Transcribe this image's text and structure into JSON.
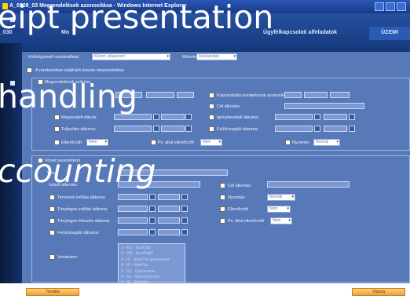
{
  "window": {
    "title": "A_0308_03 Megrendelések azonosítása - Windows Internet Explorer"
  },
  "header": {
    "tab_left": "_030",
    "tab_left_2": "Mo",
    "context": "_03",
    "tab_ugyf": "Ügyfélkapcsolati alfeladatok",
    "tab_uzemi": "ÜZEMI"
  },
  "top": {
    "kolts_label": "Költségviselő vasútvállalat",
    "kolts_value": "Kérem válasszon!",
    "muvelet_label": "Művelet",
    "muvelet_value": "Reklamálás",
    "all_orders_label": "A rendszerben található összes megrendelése"
  },
  "panel1": {
    "title": "Megrendelések szűrése",
    "kapcsolat": "Kapcsolódás kontaktusok azonosító:",
    "cel": "Cél állomás:",
    "megrendelt": "Megrendelt dátum:",
    "igeny": "Igénybevételi dátuma:",
    "teljesites": "Teljesítés dátuma:",
    "felulvizsgalo": "Felülvizsgáló dátuma:",
    "ellenorzott": "Ellenőrzött",
    "ellenorzott_val": "Nem",
    "pv_ellenorzott": "Pv. által ellenőrzött",
    "pv_val": "Nem",
    "nyomtav": "Nyomtáv",
    "nyomtav_val": "Normál"
  },
  "panel2": {
    "title": "Vonat paraméterei",
    "vonat_szam": "Vonat",
    "indulo": "Induló állomás:",
    "cel": "Cél állomás:",
    "tervezett": "Tervezett indítás dátuma:",
    "tenyleges_ind": "Tényleges indítás dátuma:",
    "tenyleges_erk": "Tényleges érkezés dátuma:",
    "felulvizsgalo": "Felülvizsgáló dátuma:",
    "nyomtav": "Nyomtáv",
    "nyomtav_val": "Normál",
    "ellenorzott": "Ellenőrzött",
    "ellenorzott_val": "Nem",
    "pv_ellenorzott": "Pv. által ellenőrzött",
    "pv_val": "Nem",
    "vonatnem": "Vonatnem:"
  },
  "vonatnem_options": [
    "1 - EC - EuroCity",
    "2 - EN - EuroNight",
    "3 - IC - InterCity gyorsvonat",
    "4 - IP - InterPici",
    "5 - Gy - Gyorsvonat",
    "6 - Sz - Személyvonat",
    "7 - IC - InterCity"
  ],
  "footer": {
    "left_button": "Tovább",
    "right_button": "Vissza"
  },
  "overlay": {
    "line1": "eipt presentation",
    "line2": "handling",
    "line3": "ccounting"
  }
}
